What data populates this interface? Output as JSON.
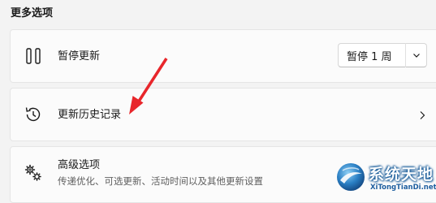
{
  "section": {
    "heading": "更多选项"
  },
  "pause_updates": {
    "title": "暂停更新",
    "icon": "pause-icon",
    "dropdown": {
      "selected": "暂停 1 周",
      "icon": "chevron-down-icon"
    }
  },
  "update_history": {
    "title": "更新历史记录",
    "icon": "history-icon",
    "nav_icon": "chevron-right-icon"
  },
  "advanced_options": {
    "title": "高级选项",
    "description": "传递优化、可选更新、活动时间以及其他更新设置",
    "icon": "gears-icon"
  },
  "annotation": {
    "arrow_color": "#e8262b"
  },
  "watermark": {
    "title": "系统天地",
    "url": "XiTongTianDi.net"
  },
  "colors": {
    "background": "#f3f3f3",
    "card": "#fbfbfb",
    "watermark_blue": "#1f5fa0"
  }
}
